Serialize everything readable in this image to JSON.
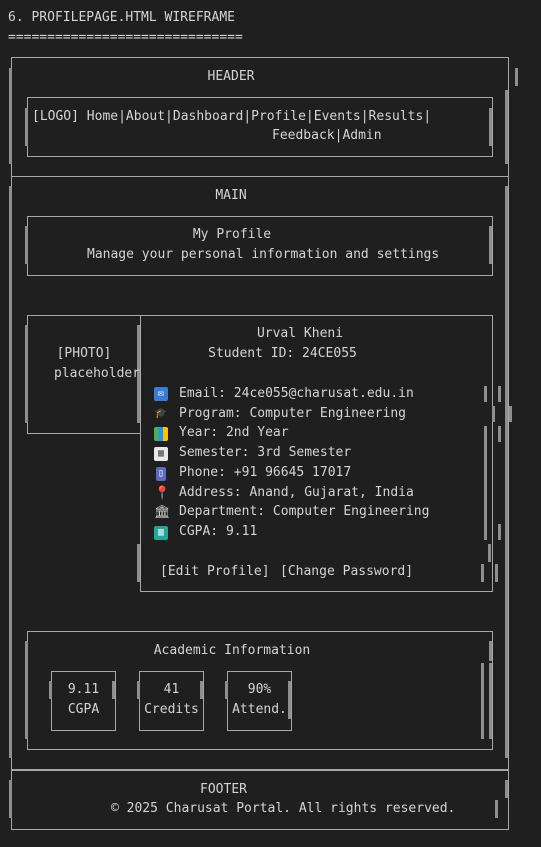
{
  "doc": {
    "title": "6. PROFILEPAGE.HTML WIREFRAME",
    "underline": "=============================="
  },
  "header": {
    "label": "HEADER",
    "nav_line1": "[LOGO] Home|About|Dashboard|Profile|Events|Results|",
    "nav_line2": "Feedback|Admin"
  },
  "main": {
    "label": "MAIN",
    "page_title": "My Profile",
    "page_subtitle": "Manage your personal information and settings",
    "photo_line1": "[PHOTO]",
    "photo_line2": "placeholder",
    "name": "Urval Kheni",
    "student_id": "Student ID: 24CE055",
    "details": [
      {
        "icon": "email-icon",
        "text": "Email: 24ce055@charusat.edu.in"
      },
      {
        "icon": "graduation-cap-icon",
        "text": "Program: Computer Engineering"
      },
      {
        "icon": "books-icon",
        "text": "Year: 2nd Year"
      },
      {
        "icon": "calendar-icon",
        "text": "Semester: 3rd Semester"
      },
      {
        "icon": "phone-icon",
        "text": "Phone: +91 96645 17017"
      },
      {
        "icon": "location-pin-icon",
        "text": "Address: Anand, Gujarat, India"
      },
      {
        "icon": "bank-building-icon",
        "text": "Department: Computer Engineering"
      },
      {
        "icon": "bar-chart-icon",
        "text": "CGPA: 9.11"
      }
    ],
    "edit_profile": "[Edit Profile]",
    "change_password": "[Change Password]",
    "academic_title": "Academic Information",
    "stats": [
      {
        "value": "9.11",
        "label": "CGPA"
      },
      {
        "value": "41",
        "label": "Credits"
      },
      {
        "value": "90%",
        "label": "Attend."
      }
    ]
  },
  "footer": {
    "label": "FOOTER",
    "copyright": "© 2025 Charusat Portal. All rights reserved."
  }
}
